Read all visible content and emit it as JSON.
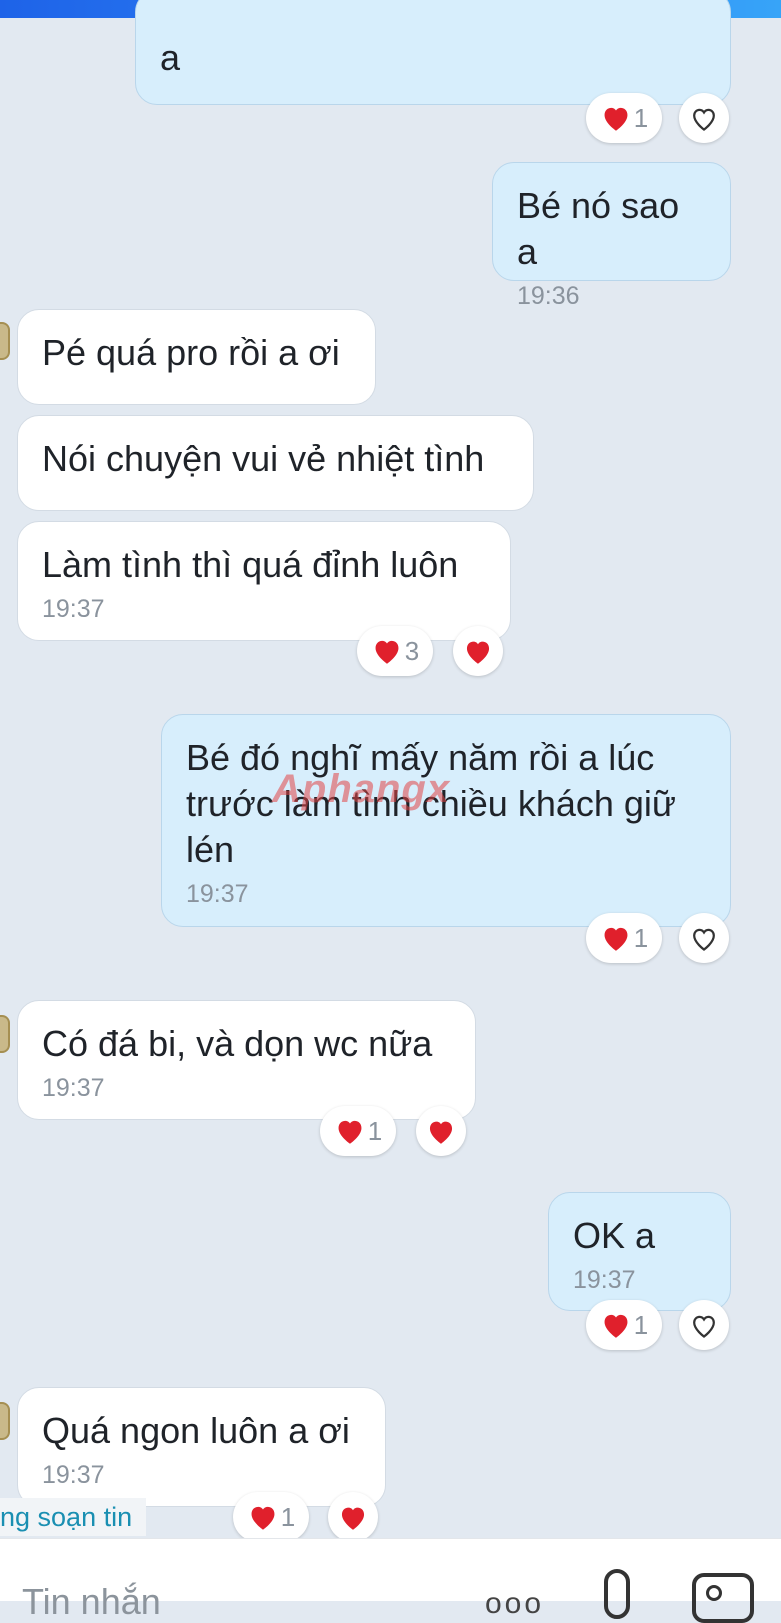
{
  "messages": [
    {
      "id": "m0",
      "text": "a",
      "time": ""
    },
    {
      "id": "m1",
      "text": "Bé nó sao a",
      "time": "19:36"
    },
    {
      "id": "m2",
      "text": "Pé quá pro rồi a ơi",
      "time": ""
    },
    {
      "id": "m3",
      "text": "Nói chuyện vui vẻ nhiệt tình",
      "time": ""
    },
    {
      "id": "m4",
      "text": "Làm tình thì quá đỉnh luôn",
      "time": "19:37"
    },
    {
      "id": "m5",
      "text": "Bé đó nghĩ mấy năm rồi a lúc trước làm tình chiều khách giữ lén",
      "time": "19:37"
    },
    {
      "id": "m6",
      "text": "Có đá bi, và dọn wc nữa",
      "time": "19:37"
    },
    {
      "id": "m7",
      "text": "OK a",
      "time": "19:37"
    },
    {
      "id": "m8",
      "text": "Quá ngon luôn a ơi",
      "time": "19:37"
    }
  ],
  "reactions": {
    "m0": {
      "count": "1"
    },
    "m4": {
      "count": "3"
    },
    "m5": {
      "count": "1"
    },
    "m6": {
      "count": "1"
    },
    "m7": {
      "count": "1"
    },
    "m8": {
      "count": "1"
    }
  },
  "watermark": "Aphangx",
  "typing_indicator": "ng soạn tin",
  "composer": {
    "placeholder": "Tin nhắn",
    "more_label": "ooo"
  },
  "colors": {
    "outgoing_bubble": "#d7eefc",
    "incoming_bubble": "#ffffff",
    "background": "#e2e9f1",
    "heart": "#e0202c",
    "top_bar": "#2f86f6"
  },
  "icons": {
    "reaction": "heart-icon",
    "react_add": "heart-outline-icon",
    "attach": "paperclip-icon",
    "image": "image-icon"
  }
}
